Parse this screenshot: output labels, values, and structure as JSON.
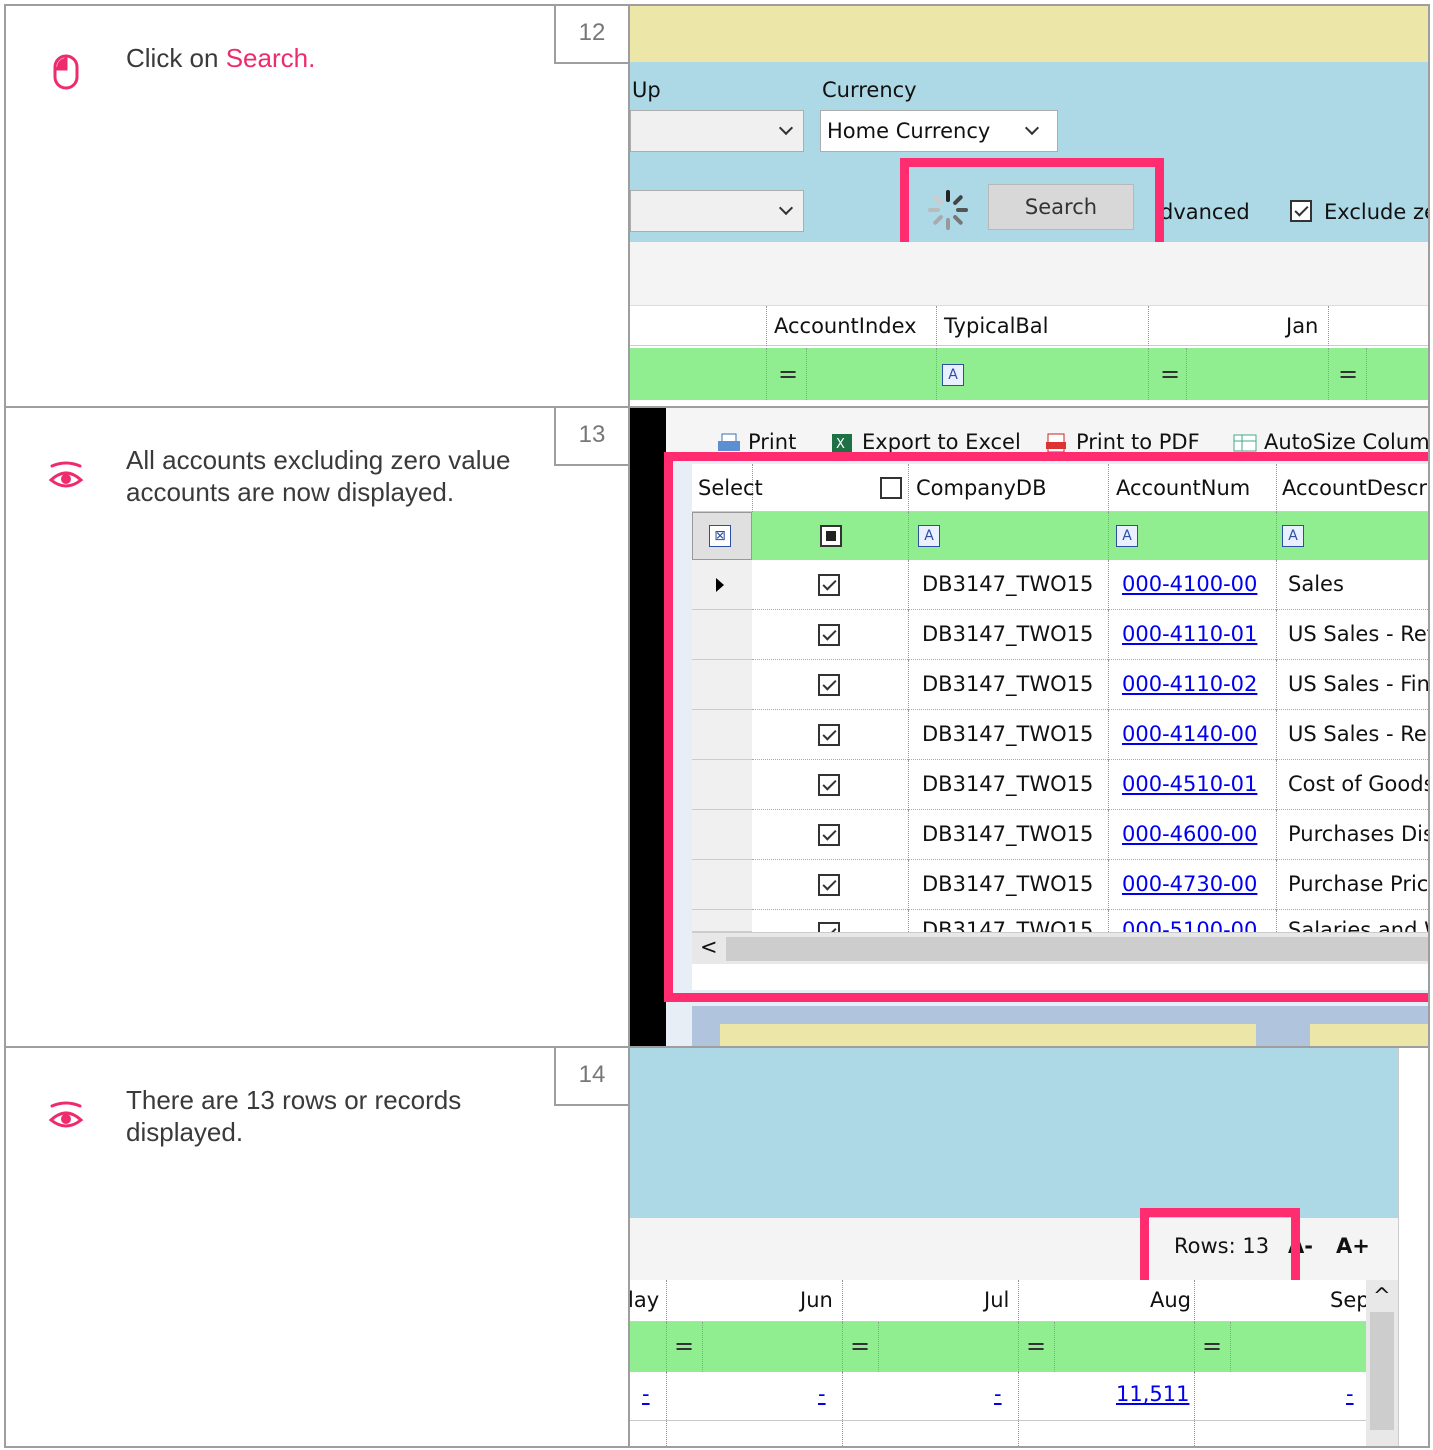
{
  "steps": [
    {
      "number": "12",
      "icon": "mouse-icon",
      "text_prefix": "Click on ",
      "text_highlight": "Search.",
      "screenshot": {
        "labels": {
          "group_partial": "Up",
          "currency": "Currency"
        },
        "currency_value": "Home Currency",
        "search_button": "Search",
        "advanced_partial": "dvanced",
        "exclude_partial": "Exclude ze",
        "columns": [
          "AccountIndex",
          "TypicalBal",
          "Jan"
        ],
        "filter_symbols": [
          "=",
          "A",
          "=",
          "="
        ]
      }
    },
    {
      "number": "13",
      "icon": "eye-icon",
      "text": "All accounts excluding zero value accounts are now displayed.",
      "screenshot": {
        "toolbar": [
          "Print",
          "Export to Excel",
          "Print to PDF",
          "AutoSize Colum"
        ],
        "columns": [
          "Select",
          "CompanyDB",
          "AccountNum",
          "AccountDescr"
        ],
        "rows": [
          {
            "company": "DB3147_TWO15",
            "account": "000-4100-00",
            "descr": "Sales"
          },
          {
            "company": "DB3147_TWO15",
            "account": "000-4110-01",
            "descr": "US Sales - Ret"
          },
          {
            "company": "DB3147_TWO15",
            "account": "000-4110-02",
            "descr": "US Sales - Fini"
          },
          {
            "company": "DB3147_TWO15",
            "account": "000-4140-00",
            "descr": "US Sales - Rep"
          },
          {
            "company": "DB3147_TWO15",
            "account": "000-4510-01",
            "descr": "Cost of Goods"
          },
          {
            "company": "DB3147_TWO15",
            "account": "000-4600-00",
            "descr": "Purchases Dis"
          },
          {
            "company": "DB3147_TWO15",
            "account": "000-4730-00",
            "descr": "Purchase Price"
          },
          {
            "company": "DB3147_TWO15",
            "account": "000-5100-00",
            "descr": "Salaries and W"
          }
        ],
        "scroll_left": "<"
      }
    },
    {
      "number": "14",
      "icon": "eye-icon",
      "text": "There are 13 rows or records displayed.",
      "screenshot": {
        "rows_label": "Rows: 13",
        "font_smaller": "A-",
        "font_larger": "A+",
        "columns": [
          "lay",
          "Jun",
          "Jul",
          "Aug",
          "Sep"
        ],
        "data_values": [
          "-",
          "-",
          "-",
          "11,511",
          "-"
        ],
        "scroll_up": "^"
      }
    }
  ],
  "colors": {
    "highlight": "#ee2b6c",
    "pink_box": "#ff2d6f",
    "panel_blue": "#add8e6",
    "filter_green": "#90ee90",
    "banner_yellow": "#ece6a8"
  }
}
